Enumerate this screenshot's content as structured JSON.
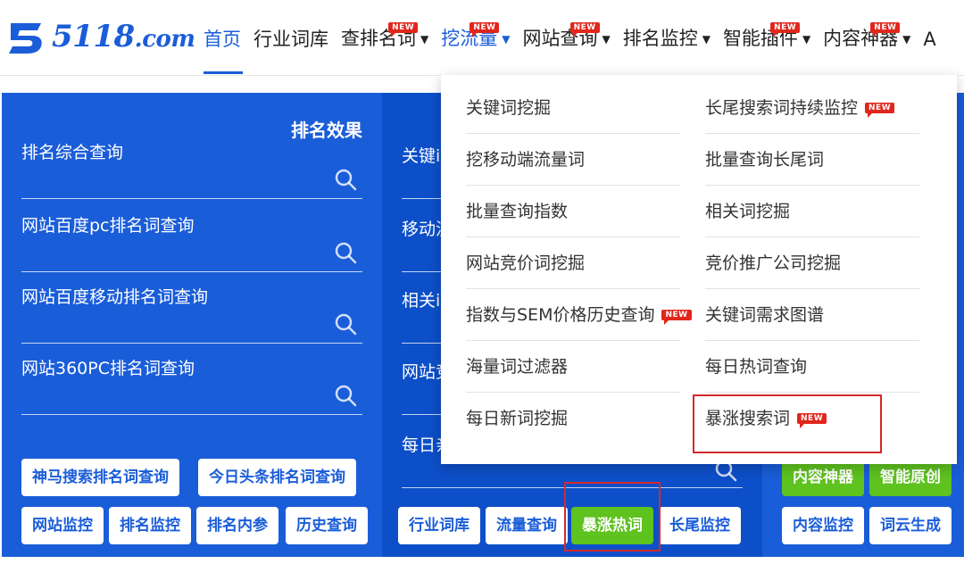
{
  "logo": {
    "text": "5118",
    "suffix": ".com"
  },
  "nav": {
    "items": [
      {
        "label": "首页",
        "caret": false,
        "new": false
      },
      {
        "label": "行业词库",
        "caret": false,
        "new": false
      },
      {
        "label": "查排名词",
        "caret": true,
        "new": true
      },
      {
        "label": "挖流量",
        "caret": true,
        "new": true
      },
      {
        "label": "网站查询",
        "caret": true,
        "new": true
      },
      {
        "label": "排名监控",
        "caret": true,
        "new": false
      },
      {
        "label": "智能插件",
        "caret": true,
        "new": true
      },
      {
        "label": "内容神器",
        "caret": true,
        "new": true
      },
      {
        "label": "A",
        "caret": false,
        "new": false
      }
    ],
    "new_tag": "NEW"
  },
  "panel1": {
    "title": "排名效果",
    "rows": [
      "排名综合查询",
      "网站百度pc排名词查询",
      "网站百度移动排名词查询",
      "网站360PC排名词查询"
    ],
    "buttons_top": [
      "神马搜索排名词查询",
      "今日头条排名词查询"
    ],
    "buttons_bottom": [
      "网站监控",
      "排名监控",
      "排名内参",
      "历史查询"
    ]
  },
  "panel2": {
    "fragments": [
      "关键i",
      "移动流",
      "相关i",
      "网站竞",
      "每日亲"
    ],
    "buttons_bottom": [
      "行业词库",
      "流量查询",
      "暴涨热词",
      "长尾监控"
    ]
  },
  "panel3": {
    "buttons_top": [
      "内容神器",
      "智能原创"
    ],
    "buttons_bottom": [
      "内容监控",
      "词云生成"
    ]
  },
  "dropdown": {
    "col1": [
      "关键词挖掘",
      "挖移动端流量词",
      "批量查询指数",
      "网站竞价词挖掘",
      "指数与SEM价格历史查询",
      "海量词过滤器",
      "每日新词挖掘"
    ],
    "col2": [
      "长尾搜索词持续监控",
      "批量查询长尾词",
      "相关词挖掘",
      "竞价推广公司挖掘",
      "关键词需求图谱",
      "每日热词查询",
      "暴涨搜索词"
    ]
  },
  "colors": {
    "brand_blue": "#1a5dd8",
    "panel_dark": "#0d4fc8",
    "green": "#5ec21f",
    "new_red": "#e1261c",
    "highlight_red": "#d42a2a"
  },
  "icons": {
    "search": "search-icon",
    "caret": "caret-down-icon"
  }
}
